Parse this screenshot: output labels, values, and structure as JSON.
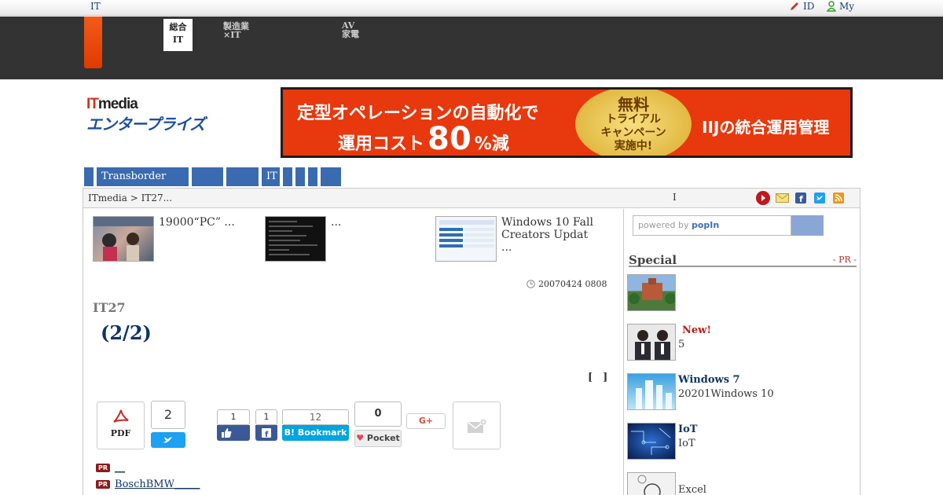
{
  "top_strip": {
    "site_label": "IT",
    "id_link": "ID",
    "my_link": "My"
  },
  "global_nav": {
    "active": {
      "line1": "総合",
      "line2": "IT"
    },
    "item2": {
      "line1": "製造業",
      "line2": "×IT"
    },
    "item3": {
      "line1": "AV",
      "line2": "家電"
    }
  },
  "logo": {
    "line1_red": "IT",
    "line1_rest": "media",
    "line2": "エンタープライズ"
  },
  "banner": {
    "line1": "定型オペレーションの自動化で",
    "line2_pre": "運用コスト",
    "line2_big": "80",
    "line2_post": "%減",
    "seal": [
      "無料",
      "トライアル",
      "キャンペーン",
      "実施中!"
    ],
    "right": "IIJの統合運用管理"
  },
  "category_tabs": [
    "Transborder",
    "",
    "",
    "IT",
    "",
    "",
    "",
    ""
  ],
  "breadcrumb": {
    "path": "ITmedia  > IT27...",
    "mark": "I"
  },
  "related": [
    {
      "title": "19000“PC” ..."
    },
    {
      "title": "..."
    },
    {
      "title": "Windows 10 Fall Creators Updat ..."
    }
  ],
  "article": {
    "date": "20070424 0808",
    "kicker": "IT27",
    "headline": "(2/2)",
    "bracket": "[　]"
  },
  "share": {
    "pdf_label": "PDF",
    "tweet_count": "2",
    "like_count": "1",
    "fb_count": "1",
    "hatena_count": "12",
    "hatena_label": "B! Bookmark",
    "pocket_count": "0",
    "pocket_label": "Pocket",
    "gplus_label": "G+"
  },
  "pr_links": [
    {
      "tag": "PR",
      "text": "__"
    },
    {
      "tag": "PR",
      "text": "BoschBMW_____"
    }
  ],
  "sidebar": {
    "search_placeholder_pre": "powered by ",
    "search_placeholder_brand": "popIn",
    "special_title": "Special",
    "special_pr": "- PR -",
    "items": [
      {
        "headline": "",
        "tag": "",
        "body": ""
      },
      {
        "headline": "",
        "tag": "New!",
        "body": "5"
      },
      {
        "headline": "Windows 7",
        "tag": "",
        "body": "20201Windows 10"
      },
      {
        "headline": "IoT",
        "tag": "",
        "body": "IoT"
      },
      {
        "headline": "",
        "tag": "",
        "body": "Excel"
      }
    ]
  },
  "colors": {
    "nav_dark": "#333333",
    "accent_orange": "#e8380d",
    "link_blue": "#0f3466",
    "tab_blue": "#3a6bb0"
  }
}
